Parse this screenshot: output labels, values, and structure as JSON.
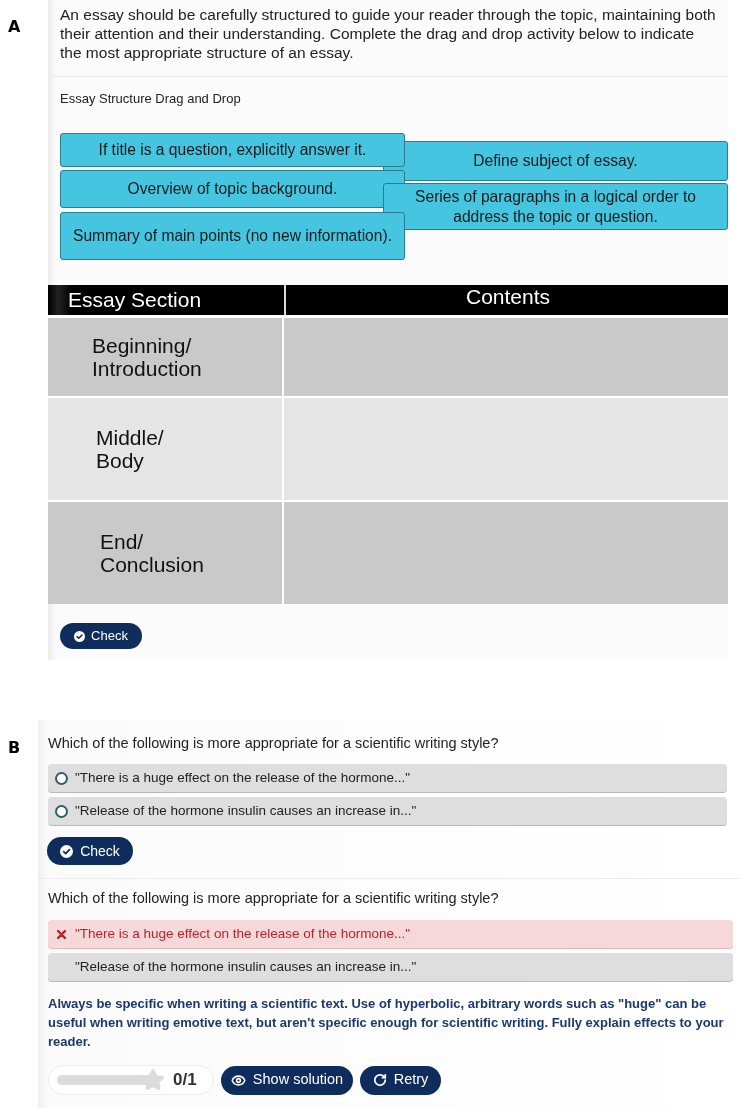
{
  "section_a": {
    "label": "A",
    "intro": "An essay should be carefully structured to guide your reader through the topic, maintaining both their attention and their understanding. Complete the drag and drop activity below to indicate the most appropriate structure of an essay.",
    "activity_title": "Essay Structure Drag and Drop",
    "draggables": [
      {
        "text": "If title is a question, explicitly answer it."
      },
      {
        "text": "Define subject of essay."
      },
      {
        "text": "Overview of topic background."
      },
      {
        "text": "Series of paragraphs in a logical order to address the topic or question."
      },
      {
        "text": "Summary of main points (no new information)."
      }
    ],
    "table": {
      "columns": [
        "Essay Section",
        "Contents"
      ],
      "rows": [
        {
          "section": "Beginning/\nIntroduction"
        },
        {
          "section": "Middle/\nBody"
        },
        {
          "section": "End/\nConclusion"
        }
      ]
    },
    "check_button": "Check"
  },
  "section_b": {
    "label": "B",
    "question_1": {
      "prompt": "Which of the following is more appropriate for a scientific writing style?",
      "options": [
        {
          "text": "\"There is a huge effect on the release of the hormone...\"",
          "selected": false
        },
        {
          "text": "\"Release of the hormone insulin causes an increase in...\"",
          "selected": false
        }
      ],
      "check_button": "Check"
    },
    "question_2": {
      "prompt": "Which of the following is more appropriate for a scientific writing style?",
      "options": [
        {
          "text": "\"There is a huge effect on the release of the hormone...\"",
          "selected": true,
          "correct": false
        },
        {
          "text": "\"Release of the hormone insulin causes an increase in...\"",
          "selected": false
        }
      ],
      "feedback": "Always be specific when writing a scientific text. Use of hyperbolic, arbitrary words such as \"huge\" can be useful when writing emotive text, but aren't specific enough for scientific writing. Fully explain effects to your reader.",
      "score": {
        "text": "0/1"
      },
      "buttons": [
        {
          "kind": "show_solution",
          "label": "Show solution"
        },
        {
          "kind": "retry",
          "label": "Retry"
        }
      ]
    }
  }
}
